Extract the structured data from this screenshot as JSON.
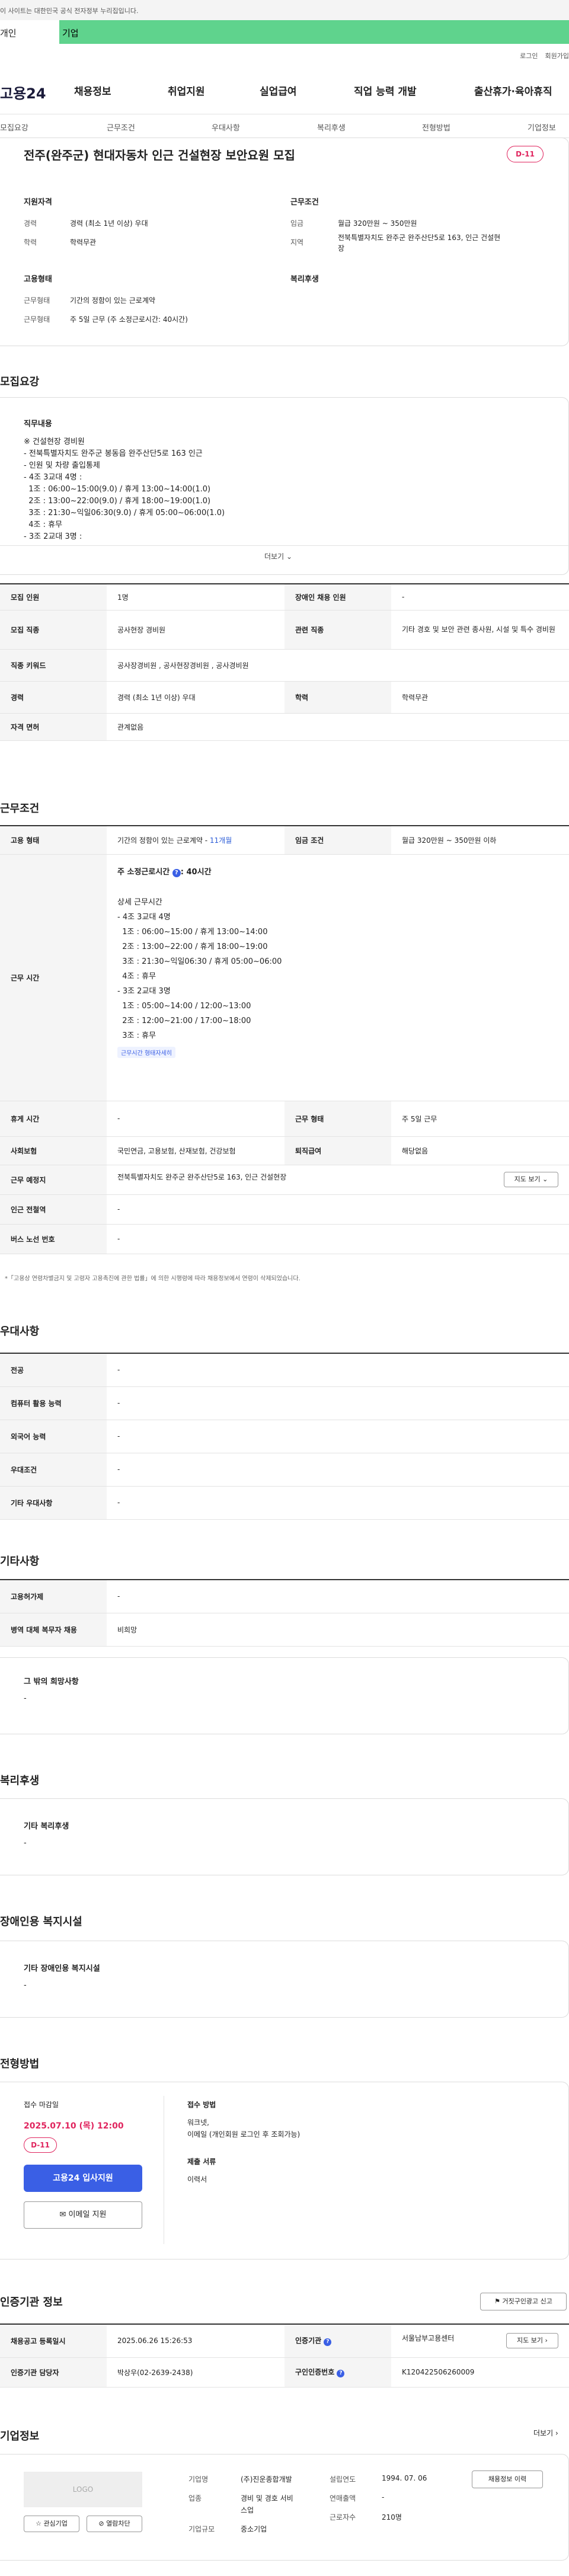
{
  "gov_notice": "이 사이트는 대한민국 공식 전자정부 누리집입니다.",
  "tabs": {
    "person": "개인",
    "business": "기업"
  },
  "util": [
    "로그인",
    "회원가입"
  ],
  "logo": "고용24",
  "gnb": [
    "채용정보",
    "취업지원",
    "실업급여",
    "직업 능력 개발",
    "출산휴가·육아휴직"
  ],
  "lnb": [
    "모집요강",
    "근무조건",
    "우대사항",
    "복리후생",
    "전형방법",
    "기관정보",
    "기업정보"
  ],
  "header": {
    "title": "전주(완주군) 현대자동차 인근 건설현장 보안요원 모집",
    "dday": "D-11"
  },
  "summary": {
    "qual_h": "지원자격",
    "career_l": "경력",
    "career_v": "경력 (최소 1년 이상) 우대",
    "edu_l": "학력",
    "edu_v": "학력무관",
    "cond_h": "근무조건",
    "wage_l": "임금",
    "wage_v": "월급 320만원 ~ 350만원",
    "region_l": "지역",
    "region_v1": "전북특별자치도 완주군 완주산단5로 163, 인근 건설현",
    "region_v2": "장",
    "emp_h": "고용형태",
    "emp_l": "근무형태",
    "emp_v": "기간의 정함이 있는 근로계약",
    "work_l": "근무형태",
    "work_v": "주 5일 근무 (주 소정근로시간: 40시간)",
    "welfare_h": "복리후생"
  },
  "recruit": {
    "h": "모집요강",
    "duty_h": "직무내용",
    "duty_lines": [
      "※ 건설현장 경비원",
      "- 전북특별자치도 완주군 봉동읍 완주산단5로 163 인근",
      "- 인원 및 차량 출입통제",
      "- 4조 3교대 4명 :",
      "  1조 : 06:00~15:00(9.0) / 휴게 13:00~14:00(1.0)",
      "  2조 : 13:00~22:00(9.0) / 휴게 18:00~19:00(1.0)",
      "  3조 : 21:30~익일06:30(9.0) / 휴게 05:00~06:00(1.0)",
      "  4조 : 휴무",
      "- 3조 2교대 3명 :"
    ],
    "more": "더보기",
    "rows": [
      {
        "a": "모집 인원",
        "av": "1명",
        "b": "장애인 채용 인원",
        "bv": "-"
      },
      {
        "a": "모집 직종",
        "av": "공사현장 경비원",
        "b": "관련 직종",
        "bv": "기타 경호 및 보안 관련 종사원, 시설 및 특수 경비원"
      },
      {
        "a": "직종 키워드",
        "av": "공사장경비원 , 공사현장경비원 , 공사경비원"
      },
      {
        "a": "경력",
        "av": "경력 (최소 1년 이상) 우대",
        "b": "학력",
        "bv": "학력무관"
      },
      {
        "a": "자격 면허",
        "av": "관계없음"
      }
    ]
  },
  "conditions": {
    "h": "근무조건",
    "emp_l": "고용 형태",
    "emp_v": "기간의 정함이 있는 근로계약 -",
    "emp_period": "11개월",
    "wage_l": "임금 조건",
    "wage_v": "월급 320만원 ~ 350만원 이하",
    "hours_l": "근무 시간",
    "hours_main": "주 소정근로시간",
    "hours_val": "40시간",
    "hours_lines": [
      "상세 근무시간",
      "- 4조 3교대 4명",
      "  1조 : 06:00~15:00 / 휴게 13:00~14:00",
      "  2조 : 13:00~22:00 / 휴게 18:00~19:00",
      "  3조 : 21:30~익일06:30 / 휴게 05:00~06:00",
      "  4조 : 휴무",
      "- 3조 2교대 3명",
      "  1조 : 05:00~14:00 / 12:00~13:00",
      "  2조 : 12:00~21:00 / 17:00~18:00",
      "  3조 : 휴무"
    ],
    "hours_link": "근무시간 형태자세히",
    "rest_l": "휴게 시간",
    "rest_v": "-",
    "type_l": "근무 형태",
    "type_v": "주 5일 근무",
    "ins_l": "사회보험",
    "ins_v": "국민연금, 고용보험, 산재보험, 건강보험",
    "ret_l": "퇴직급여",
    "ret_v": "해당없음",
    "place_l": "근무 예정지",
    "place_v": "전북특별자치도 완주군 완주산단5로 163, 인근 건설현장",
    "map_btn": "지도 보기",
    "sub_l": "인근 전철역",
    "sub_v": "-",
    "bus_l": "버스 노선 번호",
    "bus_v": "-",
    "notice": "*「고용상 연령차별금지 및 고령자 고용촉진에 관한 법률」에 의한 시행령에 따라 채용정보에서 연령이 삭제되었습니다."
  },
  "pref": {
    "h": "우대사항",
    "rows": [
      [
        "전공",
        "-"
      ],
      [
        "컴퓨터 활용 능력",
        "-"
      ],
      [
        "외국어 능력",
        "-"
      ],
      [
        "우대조건",
        "-"
      ],
      [
        "기타 우대사항",
        "-"
      ]
    ]
  },
  "etc": {
    "h": "기타사항",
    "rows": [
      [
        "고용허가제",
        "-"
      ],
      [
        "병역 대체 복무자 채용",
        "비희망"
      ]
    ],
    "hope_h": "그 밖의 희망사항",
    "hope_v": "-"
  },
  "welfare": {
    "h": "복리후생",
    "sub": "기타 복리후생",
    "v": "-"
  },
  "disabled": {
    "h": "장애인용 복지시설",
    "sub": "기타 장애인용 복지시설",
    "v": "-"
  },
  "process": {
    "h": "전형방법",
    "deadline_l": "접수 마감일",
    "deadline_v": "2025.07.10 (목) 12:00",
    "dday": "D-11",
    "apply_btn": "고용24 입사지원",
    "email_btn": "이메일 지원",
    "method_l": "접수 방법",
    "method_v1": "워크넷,",
    "method_v2": "이메일 (개인회원 로그인 후 조회가능)",
    "docs_l": "제출 서류",
    "docs_v": "이력서"
  },
  "agency": {
    "h": "인증기관 정보",
    "report_btn": "거짓구인광고 신고",
    "reg_l": "채용공고 등록일시",
    "reg_v": "2025.06.26 15:26:53",
    "org_l": "인증기관",
    "org_v": "서울남부고용센터",
    "map_btn": "지도 보기",
    "mgr_l": "인증기관 담당자",
    "mgr_v": "박상우(02-2639-2438)",
    "no_l": "구인인증번호",
    "no_v": "K120422506260009"
  },
  "company": {
    "h": "기업정보",
    "more": "더보기",
    "logo": "LOGO",
    "fav": "관심기업",
    "hide": "열람차단",
    "name_l": "기업명",
    "name_v": "(주)진운종합개발",
    "ind_l": "업종",
    "ind_v1": "경비 및 경호 서비",
    "ind_v2": "스업",
    "size_l": "기업규모",
    "size_v": "중소기업",
    "est_l": "설립연도",
    "est_v": "1994. 07. 06",
    "sales_l": "연매출액",
    "sales_v": "-",
    "emp_l": "근로자수",
    "emp_v": "210명",
    "btn": "채용정보 이력"
  }
}
